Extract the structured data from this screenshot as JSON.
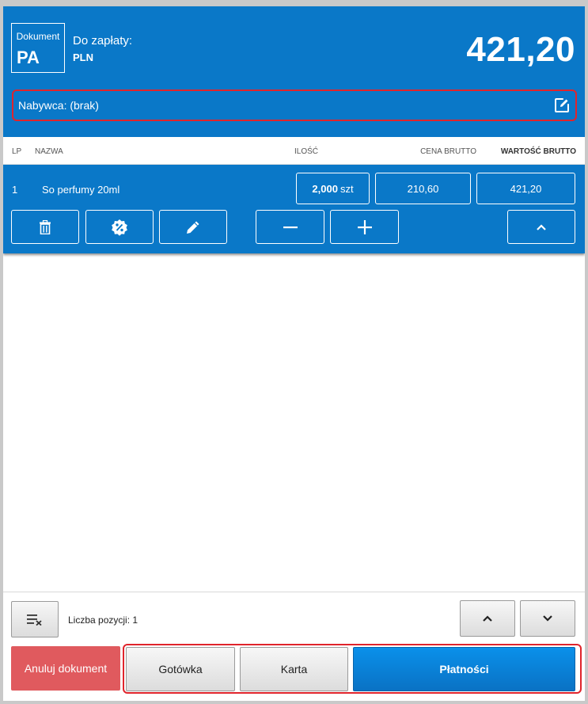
{
  "header": {
    "document_label": "Dokument",
    "document_code": "PA",
    "pay_label": "Do zapłaty:",
    "currency": "PLN",
    "total": "421,20",
    "buyer_label": "Nabywca: (brak)",
    "buyer_edit_icon": "edit-icon"
  },
  "table": {
    "columns": [
      "LP",
      "NAZWA",
      "ILOŚĆ",
      "CENA BRUTTO",
      "WARTOŚĆ BRUTTO"
    ],
    "rows": [
      {
        "lp": "1",
        "name": "So perfumy 20ml",
        "qty": "2,000",
        "unit": "szt",
        "price": "210,60",
        "value": "421,20"
      }
    ],
    "row_actions": [
      "delete-icon",
      "discount-icon",
      "edit-icon",
      "minus-icon",
      "plus-icon",
      "chevron-up-icon"
    ]
  },
  "footer": {
    "count_label": "Liczba pozycji: 1",
    "clear_icon": "clear-list-icon",
    "nav_icons": [
      "chevron-up-icon",
      "chevron-down-icon"
    ],
    "cancel_label": "Anuluj dokument",
    "cash_label": "Gotówka",
    "card_label": "Karta",
    "payments_label": "Płatności"
  },
  "colors": {
    "header_blue": "#0a78c8",
    "cancel_red": "#e05a5e",
    "highlight_red": "#e0242c",
    "payments_blue": "#0a82d8"
  }
}
